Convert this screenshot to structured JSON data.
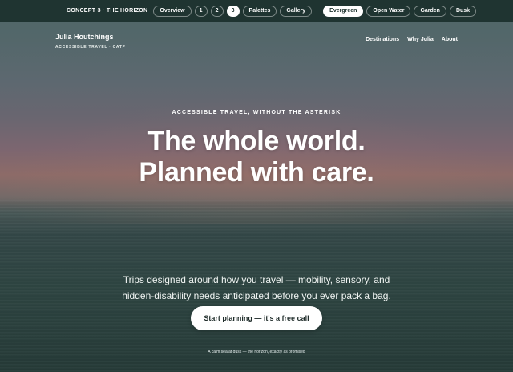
{
  "concept_bar": {
    "label": "CONCEPT 3 · THE HORIZON",
    "view_tabs": [
      {
        "label": "Overview"
      },
      {
        "label": "1"
      },
      {
        "label": "2"
      },
      {
        "label": "3",
        "active": true
      },
      {
        "label": "Palettes"
      },
      {
        "label": "Gallery"
      }
    ],
    "palette_tabs": [
      {
        "label": "Evergreen",
        "active": true
      },
      {
        "label": "Open Water"
      },
      {
        "label": "Garden"
      },
      {
        "label": "Dusk"
      }
    ]
  },
  "header": {
    "brand_name": "Julia Houtchings",
    "tagline": "ACCESSIBLE TRAVEL · CATP",
    "nav": [
      {
        "label": "Destinations"
      },
      {
        "label": "Why Julia"
      },
      {
        "label": "About"
      }
    ]
  },
  "hero": {
    "eyebrow": "ACCESSIBLE TRAVEL, WITHOUT THE ASTERISK",
    "headline_line1": "The whole world.",
    "headline_line2": "Planned with care.",
    "intro_line1": "Trips designed around how you travel — mobility, sensory, and",
    "intro_line2": "hidden-disability needs anticipated before you ever pack a bag.",
    "cta_label": "Start planning — it's a free call",
    "caption": "A calm sea at dusk — the horizon, exactly as promised"
  },
  "colors": {
    "concept_bar_background": "#1f3431",
    "active_pill_background": "#ffffff",
    "button_text": "#202d2b"
  }
}
